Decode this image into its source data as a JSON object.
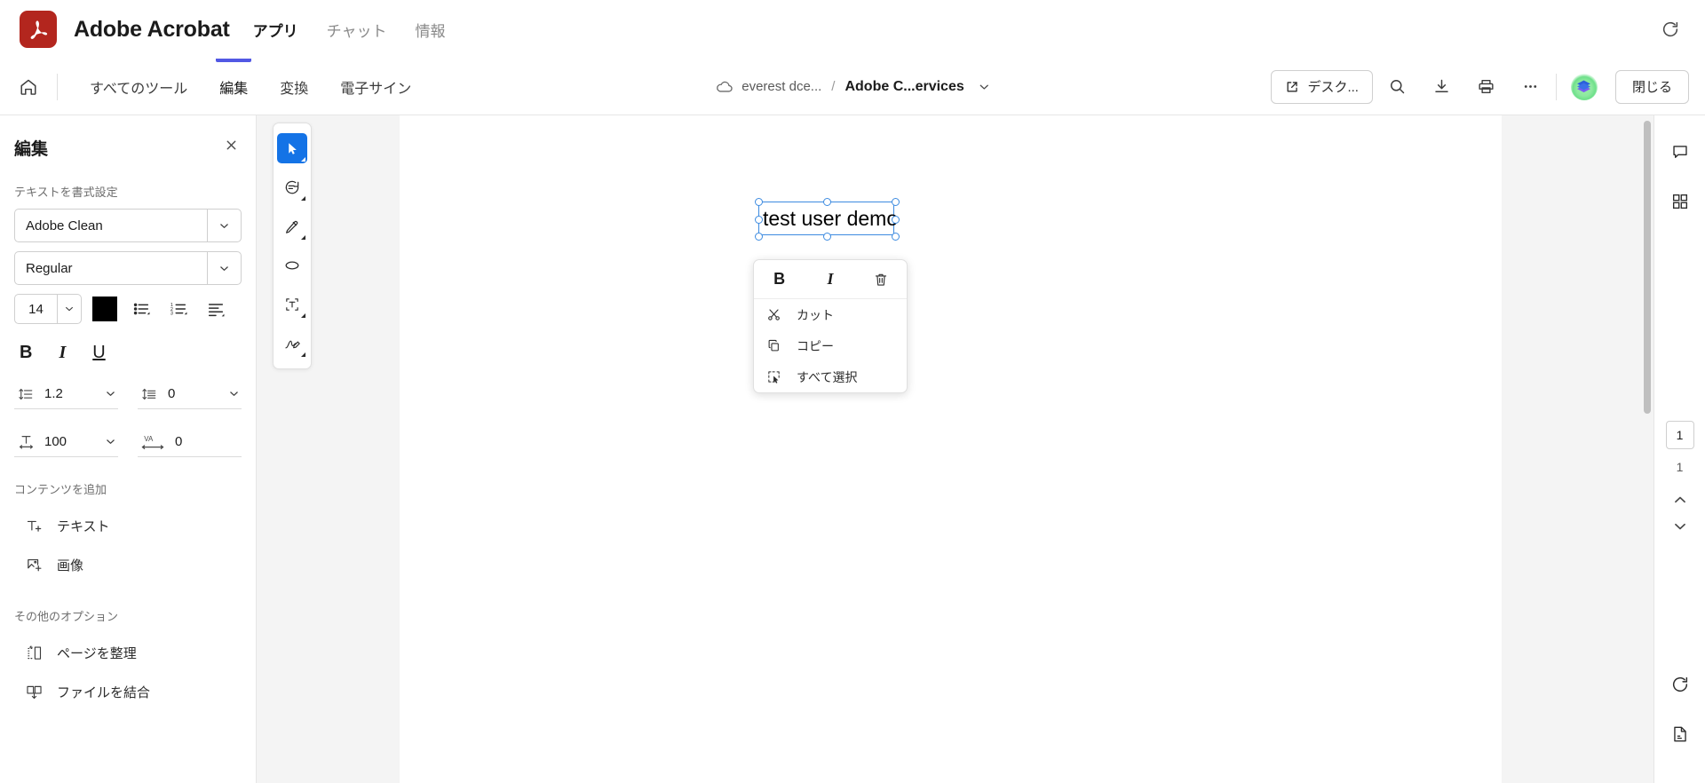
{
  "titlebar": {
    "app_title": "Adobe Acrobat",
    "nav": [
      {
        "label": "アプリ",
        "active": true
      },
      {
        "label": "チャット",
        "active": false
      },
      {
        "label": "情報",
        "active": false
      }
    ],
    "refresh_icon": "refresh-icon",
    "logo_icon": "adobe-acrobat-logo"
  },
  "toolbar": {
    "home_icon": "home-icon",
    "tabs": [
      {
        "label": "すべてのツール",
        "active": false
      },
      {
        "label": "編集",
        "active": true
      },
      {
        "label": "変換",
        "active": false
      },
      {
        "label": "電子サイン",
        "active": false
      }
    ],
    "breadcrumb": {
      "cloud_icon": "cloud-icon",
      "location": "everest dce...",
      "separator": "/",
      "file_name": "Adobe C...ervices",
      "chevron_icon": "chevron-down-icon"
    },
    "desktop_button": {
      "label": "デスク...",
      "icon": "open-external-icon"
    },
    "search_icon": "search-icon",
    "download_icon": "download-icon",
    "print_icon": "print-icon",
    "more_icon": "more-horizontal-icon",
    "avatar": "user-avatar",
    "close_label": "閉じる"
  },
  "sidebar": {
    "title": "編集",
    "close_icon": "close-icon",
    "format_text_label": "テキストを書式設定",
    "font_family": "Adobe Clean",
    "font_style": "Regular",
    "font_size": "14",
    "text_color": "#000000",
    "bullet_list_icon": "bulleted-list-icon",
    "numbered_list_icon": "numbered-list-icon",
    "align_icon": "text-align-icon",
    "bold_label": "B",
    "italic_label": "I",
    "underline_label": "U",
    "line_spacing": "1.2",
    "paragraph_spacing": "0",
    "horizontal_scale": "100",
    "tracking_label": "VA",
    "tracking_value": "0",
    "add_content_label": "コンテンツを追加",
    "add_items": [
      {
        "label": "テキスト",
        "icon": "add-text-icon"
      },
      {
        "label": "画像",
        "icon": "add-image-icon"
      }
    ],
    "more_options_label": "その他のオプション",
    "more_items": [
      {
        "label": "ページを整理",
        "icon": "organize-pages-icon"
      },
      {
        "label": "ファイルを結合",
        "icon": "combine-files-icon"
      }
    ]
  },
  "doc_tools": [
    {
      "name": "select-tool",
      "icon": "cursor-arrow-icon",
      "active": true
    },
    {
      "name": "comment-tool",
      "icon": "comment-icon",
      "active": false
    },
    {
      "name": "highlight-tool",
      "icon": "highlighter-icon",
      "active": false
    },
    {
      "name": "draw-tool",
      "icon": "ellipse-icon",
      "active": false
    },
    {
      "name": "add-textbox-tool",
      "icon": "text-box-icon",
      "active": false
    },
    {
      "name": "sign-tool",
      "icon": "signature-icon",
      "active": false
    }
  ],
  "document": {
    "textbox_value": "test user demo",
    "accent_color": "#3d8be0"
  },
  "context_menu": {
    "bold_label": "B",
    "italic_label": "I",
    "delete_icon": "trash-icon",
    "items": [
      {
        "label": "カット",
        "icon": "scissors-icon"
      },
      {
        "label": "コピー",
        "icon": "copy-icon"
      },
      {
        "label": "すべて選択",
        "icon": "select-all-icon"
      }
    ]
  },
  "right_rail": {
    "comment_icon": "comment-panel-icon",
    "thumbnails_icon": "page-thumbnails-icon",
    "current_page": "1",
    "total_pages": "1",
    "prev_icon": "chevron-up-icon",
    "next_icon": "chevron-down-icon",
    "rotate_icon": "rotate-icon",
    "export_icon": "export-pdf-icon"
  }
}
